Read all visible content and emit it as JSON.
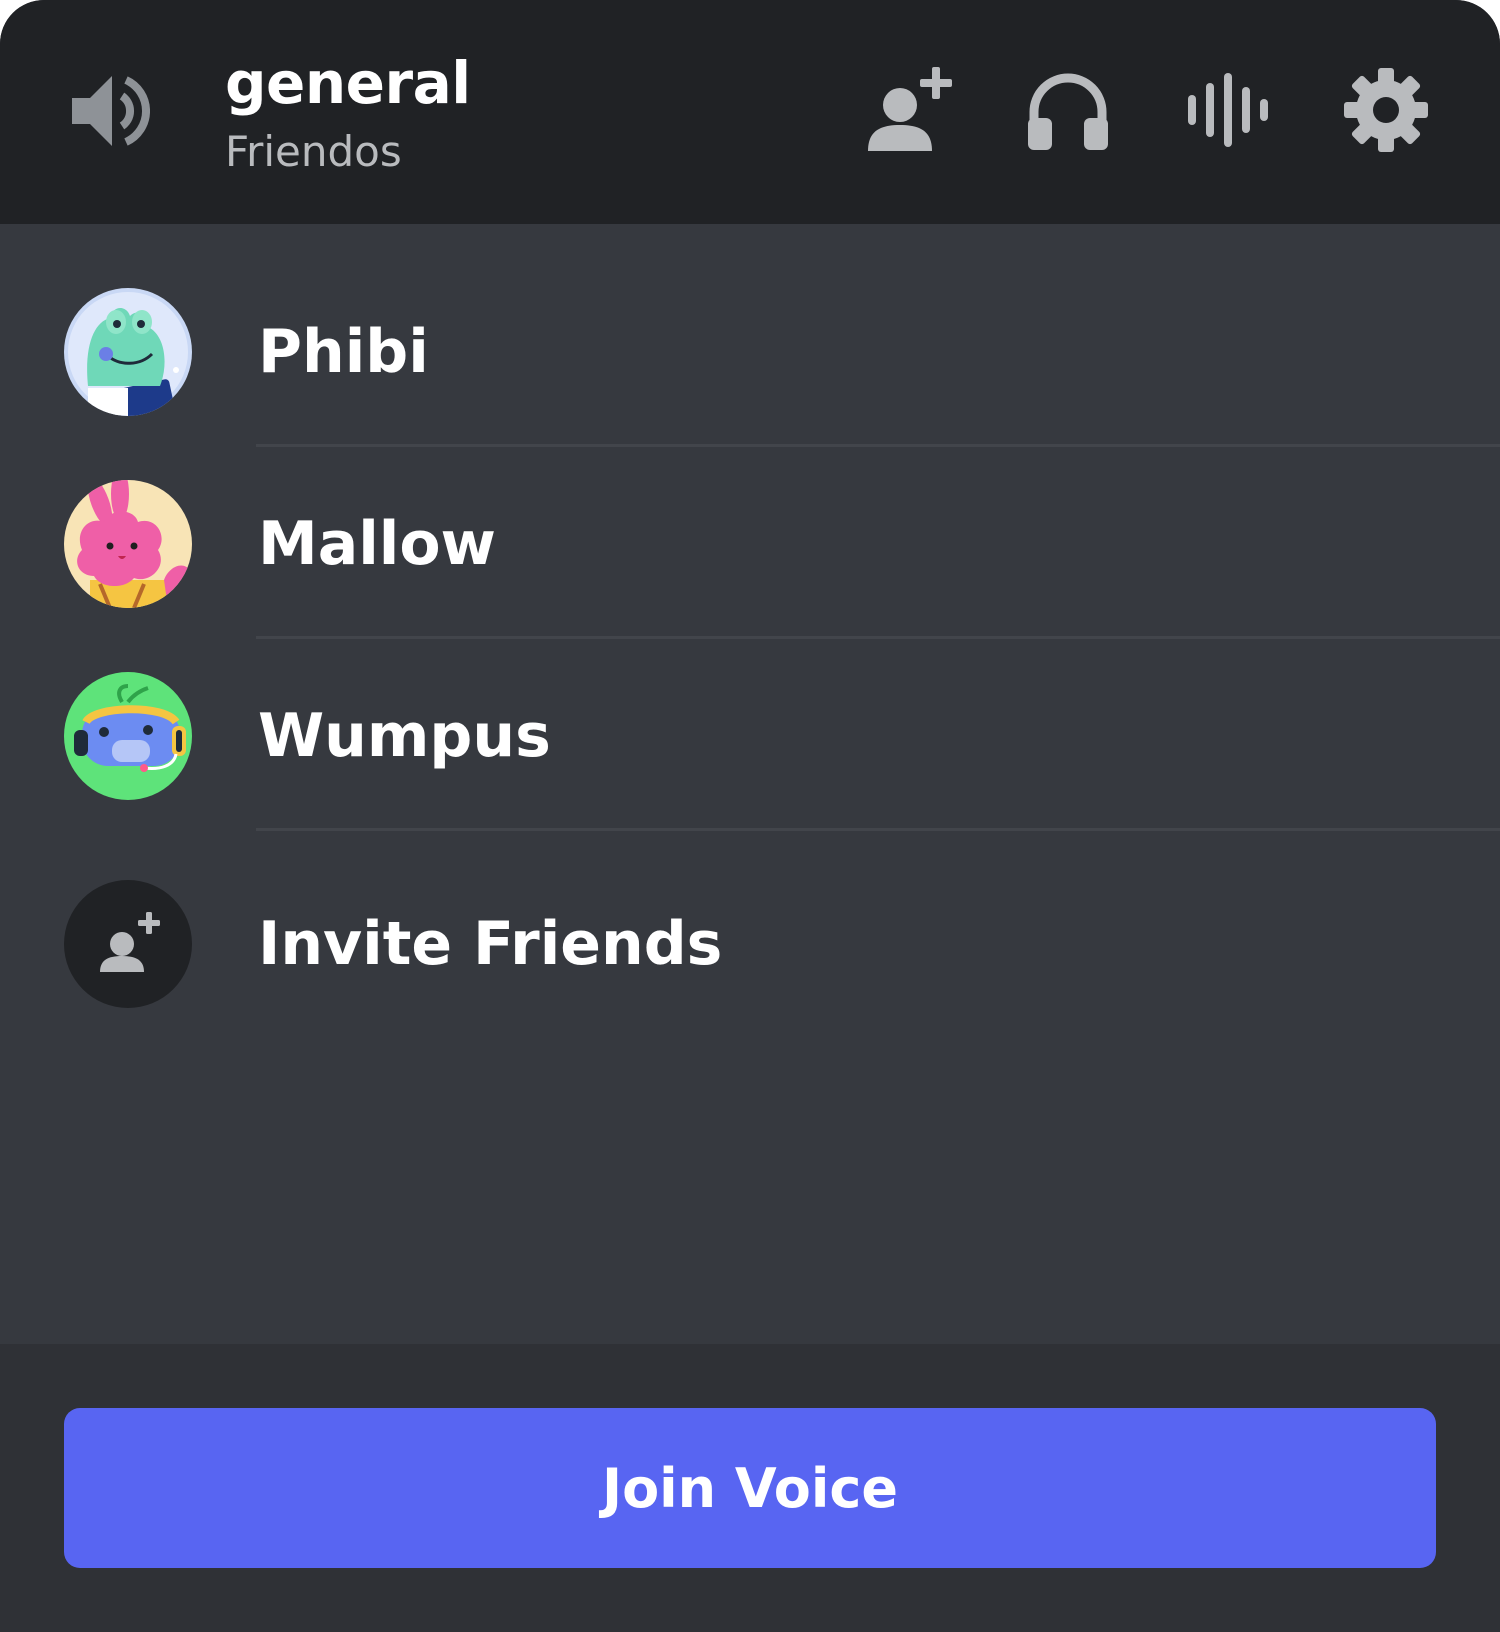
{
  "header": {
    "channel_name": "general",
    "server_name": "Friendos",
    "icons": [
      "speaker-icon",
      "add-user-icon",
      "headphones-icon",
      "waveform-icon",
      "gear-icon"
    ]
  },
  "members": [
    {
      "name": "Phibi",
      "avatar": "frog-avatar"
    },
    {
      "name": "Mallow",
      "avatar": "bunny-avatar"
    },
    {
      "name": "Wumpus",
      "avatar": "wumpus-avatar"
    }
  ],
  "invite": {
    "label": "Invite Friends",
    "icon": "add-user-icon"
  },
  "footer": {
    "join_label": "Join Voice"
  },
  "colors": {
    "header_bg": "#202225",
    "list_bg": "#36393f",
    "footer_bg": "#2f3136",
    "accent": "#5865f2",
    "icon_gray": "#b9bbbe"
  }
}
